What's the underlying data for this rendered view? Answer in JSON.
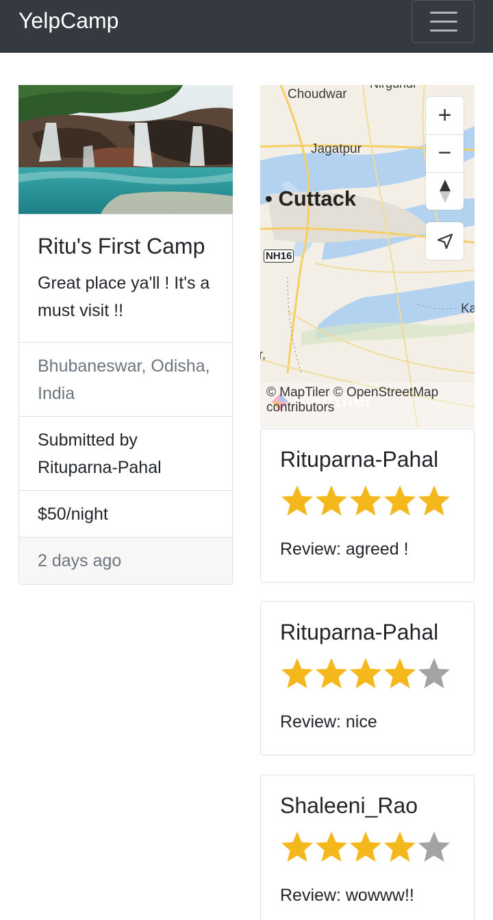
{
  "navbar": {
    "brand": "YelpCamp",
    "menu_icon": "hamburger-icon"
  },
  "campground": {
    "title": "Ritu's First Camp",
    "description": "Great place ya'll ! It's a must visit !!",
    "location": "Bhubaneswar, Odisha, India",
    "submitted_by": "Submitted by Rituparna-Pahal",
    "price": "$50/night",
    "posted": "2 days ago"
  },
  "map": {
    "labels": {
      "top_cut": "Nirgundi",
      "choudwar": "Choudwar",
      "jagatpur": "Jagatpur",
      "cuttack": "• Cuttack",
      "nh": "NH16",
      "ka": "Ka",
      "left_cut": "r,"
    },
    "logo": "maptiler",
    "attribution": "© MapTiler © OpenStreetMap contributors",
    "controls": {
      "zoom_in": "+",
      "zoom_out": "−",
      "compass_icon": "compass-icon",
      "geolocate_icon": "geolocate-arrow-icon"
    }
  },
  "reviews": [
    {
      "author": "Rituparna-Pahal",
      "rating": 5,
      "max": 5,
      "text": "Review: agreed !"
    },
    {
      "author": "Rituparna-Pahal",
      "rating": 4,
      "max": 5,
      "text": "Review: nice"
    },
    {
      "author": "Shaleeni_Rao",
      "rating": 4,
      "max": 5,
      "text": "Review: wowww!!"
    }
  ],
  "colors": {
    "navbar": "#343a40",
    "star_filled": "#f5b81c",
    "star_empty": "#a3a3a3",
    "muted": "#6c757d"
  }
}
